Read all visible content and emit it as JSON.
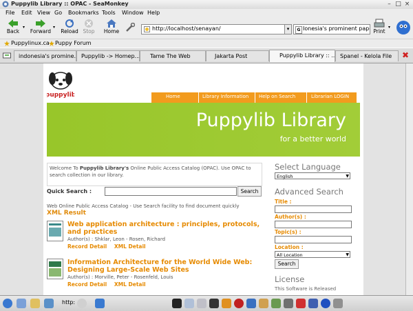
{
  "window": {
    "title": "Puppylib Library :: OPAC - SeaMonkey"
  },
  "menu": [
    "File",
    "Edit",
    "View",
    "Go",
    "Bookmarks",
    "Tools",
    "Window",
    "Help"
  ],
  "toolbar": {
    "back": "Back",
    "forward": "Forward",
    "reload": "Reload",
    "stop": "Stop",
    "home": "Home",
    "url": "http://localhost/senayan/",
    "search_value": "Ionesia's prominent paper",
    "print": "Print"
  },
  "bookmarks": [
    "Puppylinux.ca",
    "Puppy Forum"
  ],
  "tabs": [
    "indonesia's promine...",
    "Puppylib -> Homep...",
    "Tame The Web",
    "Jakarta Post",
    "Puppylib Library :: ...",
    "Spanel - Kelola File"
  ],
  "page": {
    "logo_text": "puppylib",
    "nav": [
      "Home",
      "Library Information",
      "Help on Search",
      "Librarian LOGIN"
    ],
    "banner_title": "Puppylib Library",
    "banner_tagline": "for a better world",
    "intro_pre": "Welcome To ",
    "intro_bold": "Puppylib Library's",
    "intro_rest": " Online Public Access Catalog (OPAC). Use OPAC to search collection in our library.",
    "quick_search_label": "Quick Search :",
    "search_button": "Search",
    "catalog_text": "Web Online Public Access Catalog - Use Search facility to find document quickly",
    "xml_result": "XML Result",
    "results": [
      {
        "title": "Web application architecture : principles, protocols, and practices",
        "authors": "Author(s) : Shklar, Leon - Rosen, Richard",
        "record": "Record Detail",
        "xml": "XML Detail"
      },
      {
        "title": "Information Architecture for the World Wide Web: Designing Large-Scale Web Sites",
        "authors": "Author(s) : Morville, Peter - Rosenfeld, Louis",
        "record": "Record Detail",
        "xml": "XML Detail"
      }
    ],
    "sidebar": {
      "select_language": "Select Language",
      "language_value": "English",
      "advanced_search": "Advanced Search",
      "title_label": "Title :",
      "authors_label": "Author(s) :",
      "topics_label": "Topic(s) :",
      "location_label": "Location :",
      "location_value": "All Location",
      "search_button": "Search",
      "license_heading": "License",
      "license_text": "This Software is Released"
    }
  },
  "taskbar": {
    "task_label": "http:"
  }
}
